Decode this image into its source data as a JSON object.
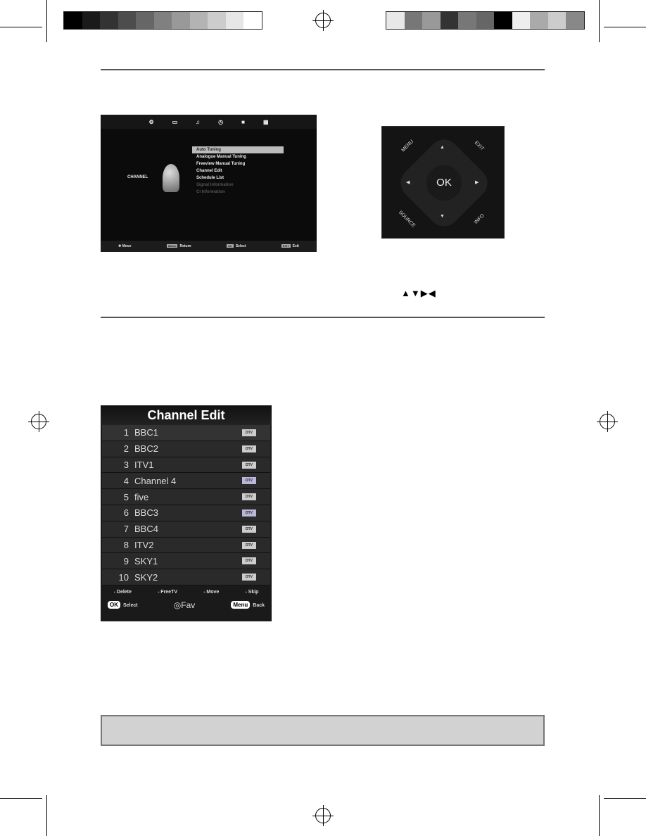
{
  "color_bars": {
    "left": [
      "#000000",
      "#1a1a1a",
      "#333333",
      "#4d4d4d",
      "#666666",
      "#808080",
      "#999999",
      "#b3b3b3",
      "#cccccc",
      "#e6e6e6",
      "#ffffff"
    ],
    "right": [
      "#e8e8e8",
      "#777777",
      "#999999",
      "#333333",
      "#777777",
      "#666666",
      "#000000",
      "#eeeeee",
      "#aaaaaa",
      "#cccccc",
      "#888888"
    ]
  },
  "tv_menu": {
    "tab_icons": [
      "gear-icon",
      "picture-icon",
      "music-icon",
      "clock-icon",
      "lock-icon",
      "grid-icon"
    ],
    "category": "CHANNEL",
    "items": [
      {
        "label": "Auto Tuning"
      },
      {
        "label": "Analogue Manual Tuning"
      },
      {
        "label": "Freeview Manual Tuning"
      },
      {
        "label": "Channel Edit"
      },
      {
        "label": "Schedule List"
      },
      {
        "label": "Signal Information"
      },
      {
        "label": "CI Information"
      }
    ],
    "footer": {
      "move": "Move",
      "return_key": "MENU",
      "return": "Return",
      "select_key": "OK",
      "select": "Select",
      "exit_key": "EXIT",
      "exit": "Exit"
    }
  },
  "remote": {
    "menu": "MENU",
    "exit": "EXIT",
    "ok": "OK",
    "source": "SOURCE",
    "info": "INFO"
  },
  "arrows_text": "▲▼▶◀",
  "channel_edit": {
    "title": "Channel Edit",
    "channels": [
      {
        "num": "1",
        "name": "BBC1",
        "type": "DTV"
      },
      {
        "num": "2",
        "name": "BBC2",
        "type": "DTV"
      },
      {
        "num": "3",
        "name": "ITV1",
        "type": "DTV"
      },
      {
        "num": "4",
        "name": "Channel 4",
        "type": "DTV"
      },
      {
        "num": "5",
        "name": "five",
        "type": "DTV"
      },
      {
        "num": "6",
        "name": "BBC3",
        "type": "DTV"
      },
      {
        "num": "7",
        "name": "BBC4",
        "type": "DTV"
      },
      {
        "num": "8",
        "name": "ITV2",
        "type": "DTV"
      },
      {
        "num": "9",
        "name": "SKY1",
        "type": "DTV"
      },
      {
        "num": "10",
        "name": "SKY2",
        "type": "DTV"
      }
    ],
    "legend": {
      "delete": "Delete",
      "freetv": "FreeTV",
      "move": "Move",
      "skip": "Skip",
      "ok_key": "OK",
      "select": "Select",
      "fav": "Fav",
      "menu_key": "Menu",
      "back": "Back"
    }
  }
}
